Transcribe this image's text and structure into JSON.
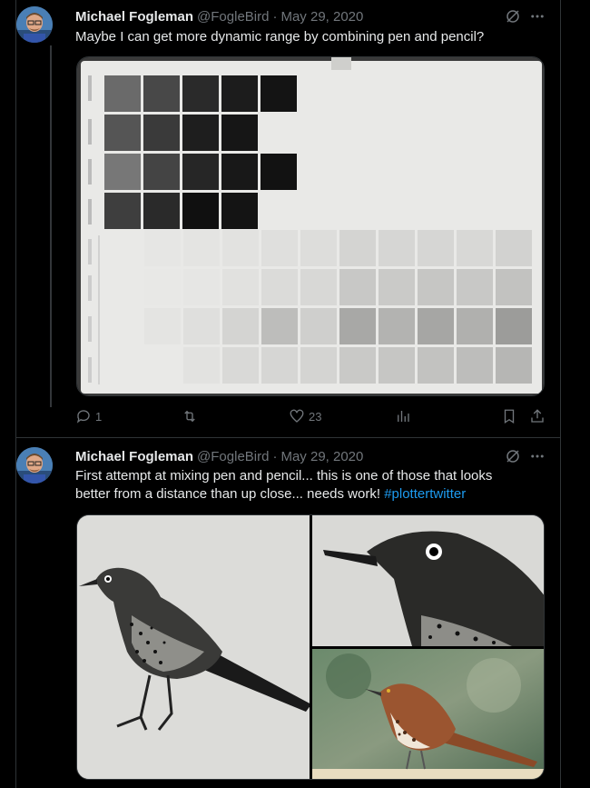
{
  "tweets": [
    {
      "author_name": "Michael Fogleman",
      "handle": "@FogleBird",
      "separator": "·",
      "date": "May 29, 2020",
      "text": "Maybe I can get more dynamic range by combining pen and pencil?",
      "replies": "1",
      "retweets": "",
      "likes": "23"
    },
    {
      "author_name": "Michael Fogleman",
      "handle": "@FogleBird",
      "separator": "·",
      "date": "May 29, 2020",
      "text_line1": "First attempt at mixing pen and pencil... this is one of those that looks",
      "text_line2": "better from a distance than up close... needs work! ",
      "hashtag": "#plottertwitter"
    }
  ],
  "icons": {
    "avatar": "avatar",
    "grok": "grok-icon",
    "more": "more-icon",
    "reply": "reply-icon",
    "retweet": "retweet-icon",
    "like": "like-icon",
    "views": "views-icon",
    "bookmark": "bookmark-icon",
    "share": "share-icon"
  },
  "colors": {
    "background": "#000000",
    "text": "#e7e9ea",
    "muted": "#71767b",
    "link": "#1d9bf0",
    "border": "#2f3336"
  }
}
